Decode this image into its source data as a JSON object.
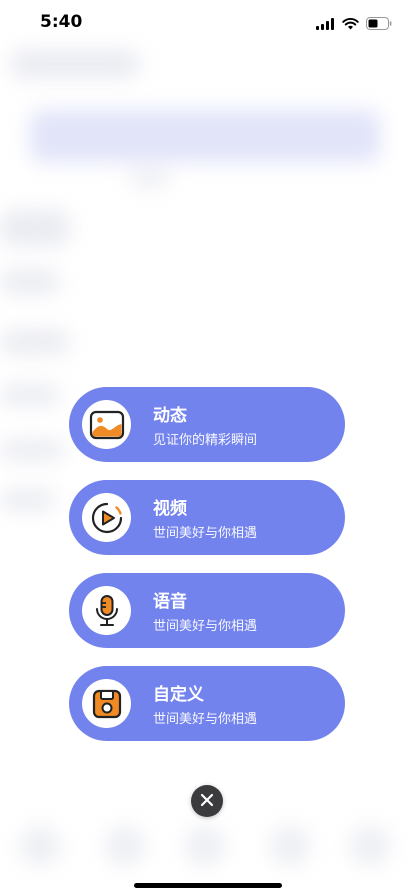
{
  "status_bar": {
    "time": "5:40"
  },
  "menu": {
    "items": [
      {
        "title": "动态",
        "subtitle": "见证你的精彩瞬间",
        "icon": "image-icon"
      },
      {
        "title": "视频",
        "subtitle": "世间美好与你相遇",
        "icon": "play-icon"
      },
      {
        "title": "语音",
        "subtitle": "世间美好与你相遇",
        "icon": "microphone-icon"
      },
      {
        "title": "自定义",
        "subtitle": "世间美好与你相遇",
        "icon": "custom-icon"
      }
    ]
  },
  "colors": {
    "card": "#7383ee",
    "icon_accent": "#f08a24",
    "icon_outline": "#222222",
    "close_button": "#3b3b3d"
  }
}
